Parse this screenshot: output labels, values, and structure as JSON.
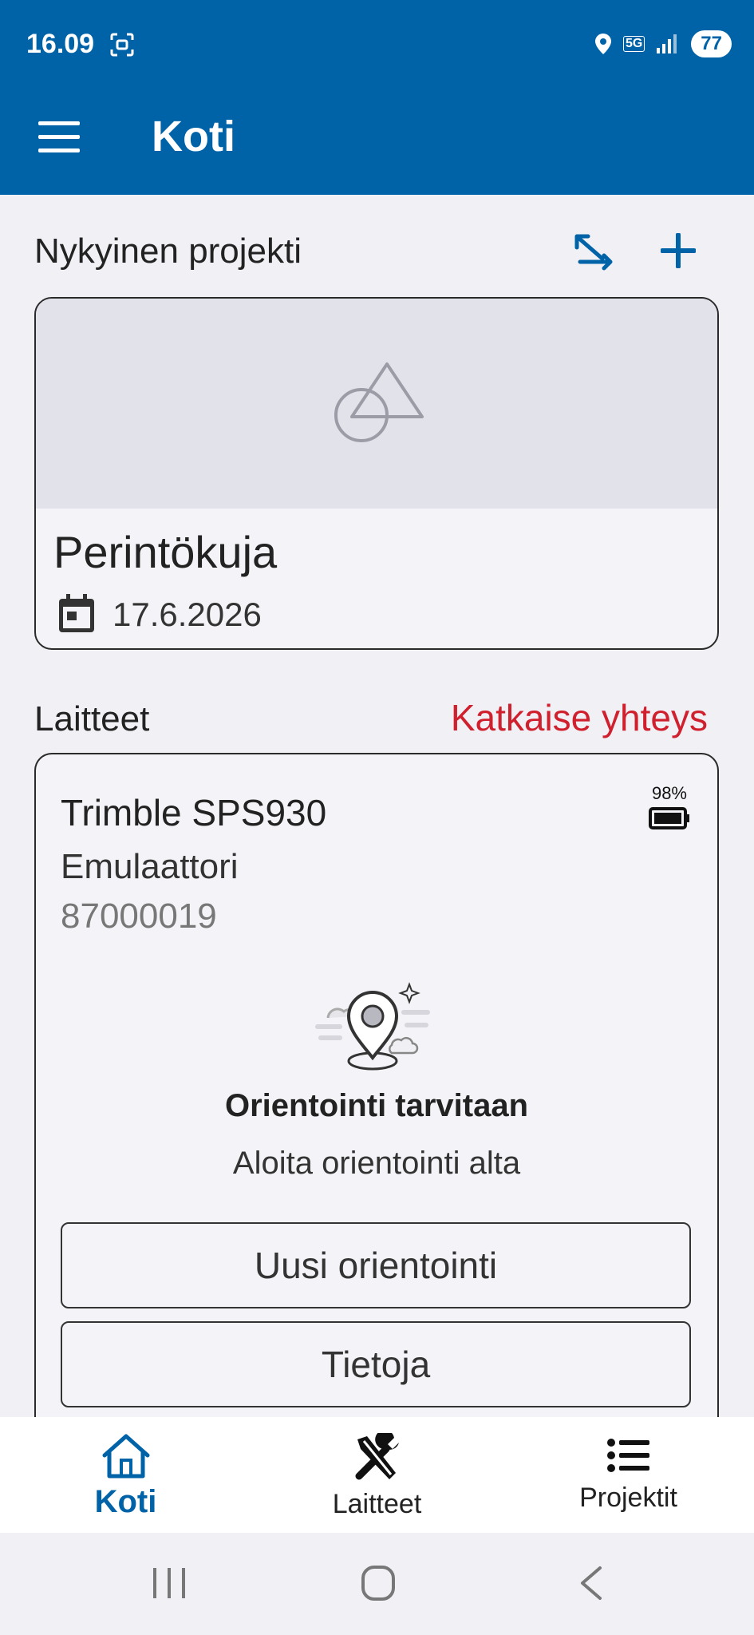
{
  "status_bar": {
    "time": "16.09",
    "network": "5G",
    "battery": "77"
  },
  "header": {
    "title": "Koti"
  },
  "project_section": {
    "title": "Nykyinen projekti"
  },
  "project": {
    "name": "Perintökuja",
    "date": "17.6.2026"
  },
  "devices_section": {
    "title": "Laitteet",
    "disconnect_label": "Katkaise yhteys"
  },
  "device": {
    "name": "Trimble SPS930",
    "type": "Emulaattori",
    "serial": "87000019",
    "battery_percent": "98%",
    "orientation_title": "Orientointi tarvitaan",
    "orientation_subtitle": "Aloita orientointi alta",
    "new_orientation_label": "Uusi orientointi",
    "info_label": "Tietoja"
  },
  "bottom_nav": {
    "items": [
      {
        "label": "Koti",
        "icon": "home-icon",
        "active": true
      },
      {
        "label": "Laitteet",
        "icon": "tools-icon",
        "active": false
      },
      {
        "label": "Projektit",
        "icon": "list-icon",
        "active": false
      }
    ]
  },
  "colors": {
    "brand": "#0063a8",
    "danger": "#d0202e",
    "background": "#f0f0f5"
  }
}
